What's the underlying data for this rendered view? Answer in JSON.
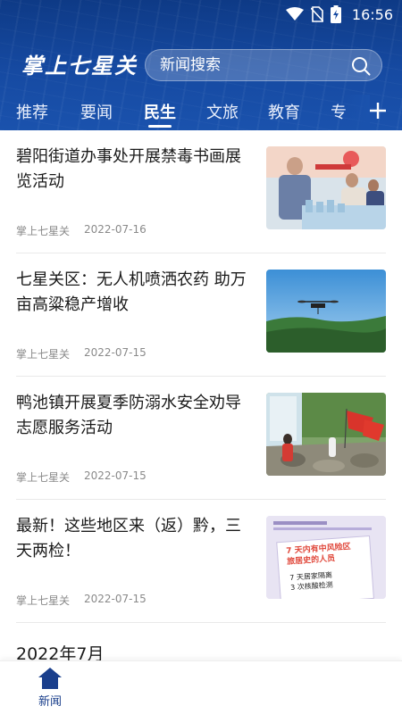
{
  "status_bar": {
    "time": "16:56",
    "icons": [
      "wifi-icon",
      "no-sim-icon",
      "battery-icon"
    ]
  },
  "header": {
    "logo_text": "掌上七星关",
    "search": {
      "placeholder": "新闻搜索"
    },
    "tabs": [
      {
        "label": "推荐",
        "active": false
      },
      {
        "label": "要闻",
        "active": false
      },
      {
        "label": "民生",
        "active": true
      },
      {
        "label": "文旅",
        "active": false
      },
      {
        "label": "教育",
        "active": false
      },
      {
        "label": "专",
        "active": false
      }
    ],
    "add_tab_icon": "plus-icon"
  },
  "news": [
    {
      "title": "碧阳街道办事处开展禁毒书画展览活动",
      "source": "掌上七星关",
      "date": "2022-07-16",
      "thumb": "event-photo"
    },
    {
      "title": "七星关区：无人机喷洒农药 助万亩高粱稳产增收",
      "source": "掌上七星关",
      "date": "2022-07-15",
      "thumb": "drone-photo"
    },
    {
      "title": "鸭池镇开展夏季防溺水安全劝导志愿服务活动",
      "source": "掌上七星关",
      "date": "2022-07-15",
      "thumb": "volunteer-photo"
    },
    {
      "title": "最新！这些地区来（返）黔，三天两检！",
      "source": "掌上七星关",
      "date": "2022-07-15",
      "thumb": "notice-graphic"
    }
  ],
  "notice_thumb_text": {
    "line1": "7 天内有中风险区",
    "line2": "旅居史的人员",
    "line3": "7 天居家隔离",
    "line4": "3 次核酸检测"
  },
  "month_header": "2022年7月",
  "bottom_nav": {
    "items": [
      {
        "label": "新闻",
        "icon": "home-icon",
        "active": true
      }
    ]
  },
  "colors": {
    "header_blue": "#164aa2",
    "nav_blue": "#1a3f8c",
    "meta_gray": "#8a8a8a"
  }
}
